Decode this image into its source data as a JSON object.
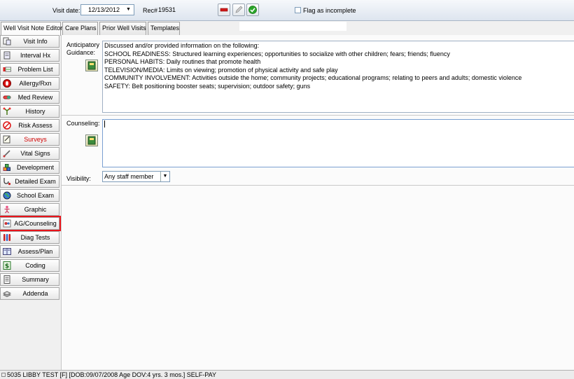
{
  "header": {
    "visit_date_label": "Visit date:",
    "visit_date_value": "12/13/2012",
    "rec_label": "Rec#",
    "rec_value": "19531",
    "flag_label": "Flag as incomplete"
  },
  "tabs": [
    "Well Visit Note Editor",
    "Care Plans",
    "Prior Well Visits",
    "Templates"
  ],
  "sidebar": {
    "items": [
      {
        "label": "Visit Info"
      },
      {
        "label": "Interval Hx"
      },
      {
        "label": "Problem List"
      },
      {
        "label": "Allergy/Rxn"
      },
      {
        "label": "Med Review"
      },
      {
        "label": "History"
      },
      {
        "label": "Risk Assess"
      },
      {
        "label": "Surveys"
      },
      {
        "label": "Vital Signs"
      },
      {
        "label": "Development"
      },
      {
        "label": "Detailed Exam"
      },
      {
        "label": "School Exam"
      },
      {
        "label": "Graphic"
      },
      {
        "label": "AG/Counseling"
      },
      {
        "label": "Diag Tests"
      },
      {
        "label": "Assess/Plan"
      },
      {
        "label": "Coding"
      },
      {
        "label": "Summary"
      },
      {
        "label": "Addenda"
      }
    ]
  },
  "main": {
    "ag_label_line1": "Anticipatory",
    "ag_label_line2": "Guidance:",
    "ag_lines": [
      "Discussed and/or provided information on the following:",
      "SCHOOL READINESS: Structured learning experiences; opportunities to socialize with other children; fears; friends; fluency",
      "PERSONAL HABITS: Daily routines that promote health",
      "TELEVISION/MEDIA: Limits on viewing; promotion of physical activity and safe play",
      "COMMUNITY INVOLVEMENT: Activities outside the home; community projects; educational programs; relating to peers and adults; domestic violence",
      "SAFETY: Belt positioning booster seats; supervision; outdoor safety; guns"
    ],
    "counseling_label": "Counseling:",
    "counseling_value": "",
    "visibility_label": "Visibility:",
    "visibility_value": "Any staff member"
  },
  "status": {
    "text": "5035 LIBBY TEST  [F]  [DOB:09/07/2008  Age DOV:4 yrs. 3 mos.]  SELF-PAY"
  }
}
